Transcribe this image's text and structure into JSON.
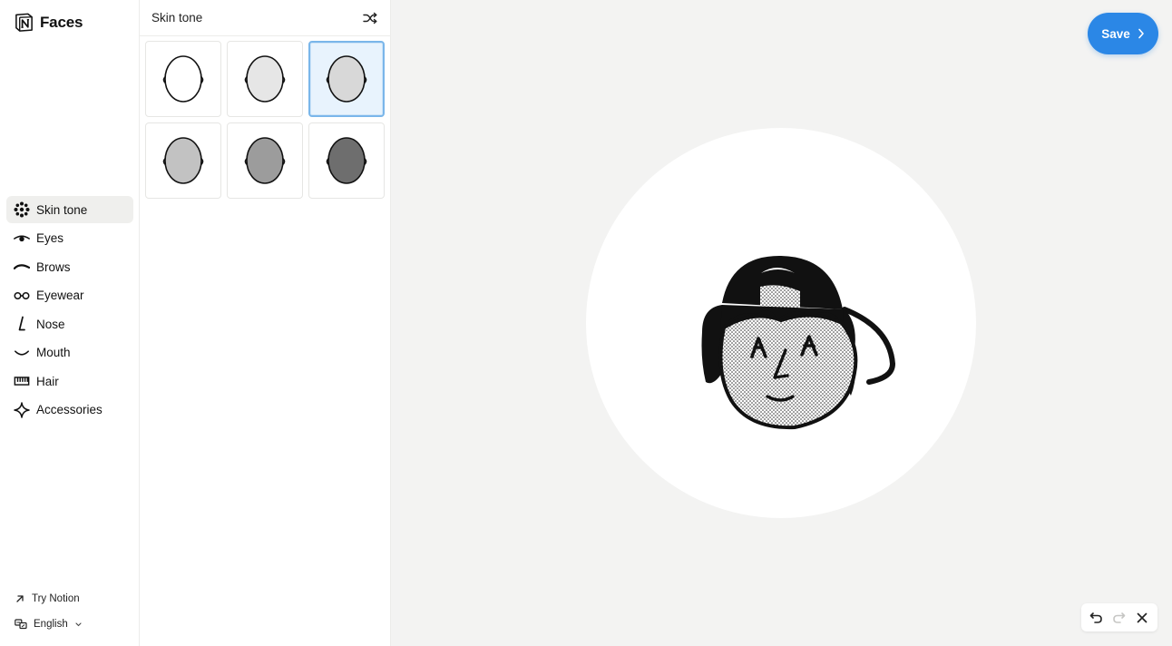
{
  "app": {
    "name": "Faces",
    "logo": "notion-logo"
  },
  "sidebar": {
    "items": [
      {
        "label": "Skin tone",
        "icon": "palette-dots-icon",
        "active": true
      },
      {
        "label": "Eyes",
        "icon": "eye-icon"
      },
      {
        "label": "Brows",
        "icon": "brow-icon"
      },
      {
        "label": "Eyewear",
        "icon": "glasses-icon"
      },
      {
        "label": "Nose",
        "icon": "nose-icon"
      },
      {
        "label": "Mouth",
        "icon": "mouth-icon"
      },
      {
        "label": "Hair",
        "icon": "comb-icon"
      },
      {
        "label": "Accessories",
        "icon": "sparkle-icon"
      }
    ],
    "footer": {
      "try_label": "Try Notion",
      "language_label": "English"
    }
  },
  "panel": {
    "title": "Skin tone",
    "shuffle_icon": "shuffle-icon",
    "options": [
      {
        "shade": "#ffffff",
        "selected": false
      },
      {
        "shade": "#e6e6e6",
        "selected": false
      },
      {
        "shade": "#d8d8d8",
        "selected": true
      },
      {
        "shade": "#c2c2c2",
        "selected": false
      },
      {
        "shade": "#9c9c9c",
        "selected": false
      },
      {
        "shade": "#6e6e6e",
        "selected": false
      }
    ]
  },
  "canvas": {
    "save_label": "Save",
    "toolbar": {
      "undo_icon": "undo-icon",
      "redo_icon": "redo-icon",
      "close_icon": "close-icon"
    }
  },
  "colors": {
    "accent": "#2b87e6",
    "selected_tile_bg": "#e8f3fd",
    "selected_tile_border": "#7ab6ea",
    "canvas_bg": "#f3f3f2"
  }
}
